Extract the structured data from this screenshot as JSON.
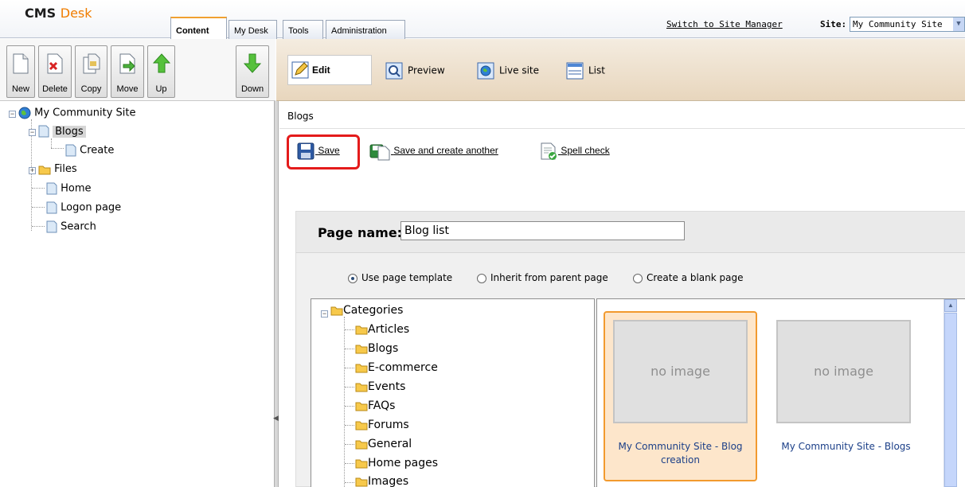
{
  "header": {
    "logo_cms": "CMS",
    "logo_desk": "Desk",
    "tabs": [
      {
        "label": "Content",
        "active": true
      },
      {
        "label": "My Desk",
        "active": false
      },
      {
        "label": "Tools",
        "active": false
      },
      {
        "label": "Administration",
        "active": false
      }
    ],
    "switch_link": "Switch to Site Manager",
    "site_label": "Site:",
    "site_value": "My Community Site"
  },
  "doc_toolbar": {
    "buttons": [
      "New",
      "Delete",
      "Copy",
      "Move",
      "Up",
      "Down"
    ]
  },
  "modes": {
    "edit": "Edit",
    "preview": "Preview",
    "live_site": "Live site",
    "list": "List"
  },
  "tree": {
    "root": "My Community Site",
    "blogs": "Blogs",
    "create": "Create",
    "files": "Files",
    "home": "Home",
    "logon": "Logon page",
    "search": "Search"
  },
  "breadcrumb": "Blogs",
  "actions": {
    "save": "Save",
    "save_create": "Save and create another",
    "spell": "Spell check"
  },
  "form": {
    "page_name_label": "Page name:",
    "page_name_value": "Blog list",
    "radios": [
      {
        "label": "Use page template",
        "checked": true
      },
      {
        "label": "Inherit from parent page",
        "checked": false
      },
      {
        "label": "Create a blank page",
        "checked": false
      }
    ],
    "categories_root": "Categories",
    "categories": [
      "Articles",
      "Blogs",
      "E-commerce",
      "Events",
      "FAQs",
      "Forums",
      "General",
      "Home pages",
      "Images"
    ],
    "templates": [
      {
        "image_text": "no image",
        "caption": "My Community Site - Blog creation",
        "selected": true
      },
      {
        "image_text": "no image",
        "caption": "My Community Site - Blogs",
        "selected": false
      }
    ]
  },
  "colors": {
    "accent_orange": "#f07d00",
    "highlight_red": "#e41b1b",
    "link_blue": "#1b3f88"
  }
}
